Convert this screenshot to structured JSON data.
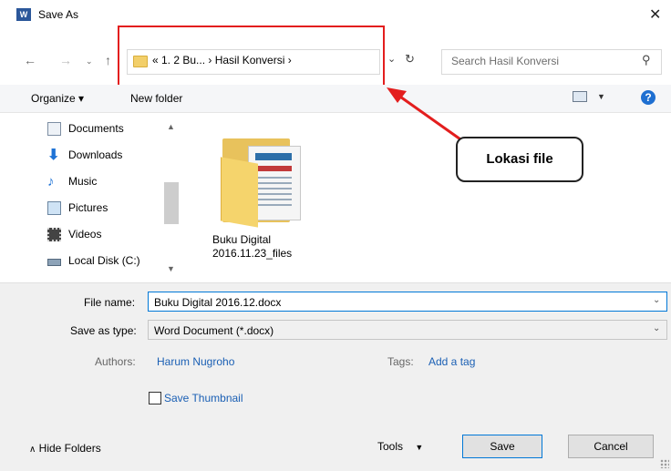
{
  "window": {
    "title": "Save As",
    "app_icon": "W"
  },
  "address_bar": {
    "path": "«  1. 2 Bu...  ›  Hasil Konversi  ›"
  },
  "search": {
    "placeholder": "Search Hasil Konversi"
  },
  "toolbar": {
    "organize": "Organize ▾",
    "new_folder": "New folder"
  },
  "sidebar": {
    "items": [
      {
        "label": "Documents",
        "icon": "documents-icon"
      },
      {
        "label": "Downloads",
        "icon": "downloads-icon"
      },
      {
        "label": "Music",
        "icon": "music-icon"
      },
      {
        "label": "Pictures",
        "icon": "pictures-icon"
      },
      {
        "label": "Videos",
        "icon": "videos-icon"
      },
      {
        "label": "Local Disk (C:)",
        "icon": "local-disk-icon"
      }
    ]
  },
  "files": [
    {
      "name_line1": "Buku Digital",
      "name_line2": "2016.11.23_files",
      "icon": "folder-icon"
    }
  ],
  "annotation": {
    "callout": "Lokasi file",
    "highlight_color": "#e31e1e"
  },
  "form": {
    "file_name_label": "File name:",
    "file_name_value": "Buku Digital 2016.12.docx",
    "save_type_label": "Save as type:",
    "save_type_value": "Word Document (*.docx)",
    "authors_label": "Authors:",
    "authors_value": "Harum Nugroho",
    "tags_label": "Tags:",
    "tags_value": "Add a tag",
    "thumbnail_label": "Save Thumbnail"
  },
  "footer": {
    "hide_folders": "Hide Folders",
    "tools": "Tools",
    "save": "Save",
    "cancel": "Cancel"
  },
  "colors": {
    "accent": "#0078d7",
    "link": "#1a5fb4",
    "folder": "#f5d46c"
  }
}
